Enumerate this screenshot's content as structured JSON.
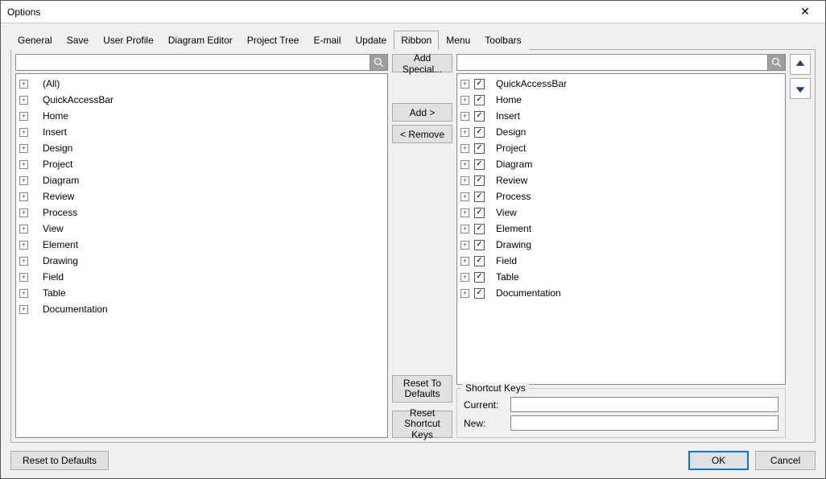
{
  "window": {
    "title": "Options"
  },
  "tabs": [
    {
      "label": "General"
    },
    {
      "label": "Save"
    },
    {
      "label": "User Profile"
    },
    {
      "label": "Diagram Editor"
    },
    {
      "label": "Project Tree"
    },
    {
      "label": "E-mail"
    },
    {
      "label": "Update"
    },
    {
      "label": "Ribbon"
    },
    {
      "label": "Menu"
    },
    {
      "label": "Toolbars"
    }
  ],
  "active_tab_index": 7,
  "left_search": "",
  "right_search": "",
  "left_tree": [
    {
      "label": "(All)"
    },
    {
      "label": "QuickAccessBar"
    },
    {
      "label": "Home"
    },
    {
      "label": "Insert"
    },
    {
      "label": "Design"
    },
    {
      "label": "Project"
    },
    {
      "label": "Diagram"
    },
    {
      "label": "Review"
    },
    {
      "label": "Process"
    },
    {
      "label": "View"
    },
    {
      "label": "Element"
    },
    {
      "label": "Drawing"
    },
    {
      "label": "Field"
    },
    {
      "label": "Table"
    },
    {
      "label": "Documentation"
    }
  ],
  "right_tree": [
    {
      "label": "QuickAccessBar",
      "checked": true
    },
    {
      "label": "Home",
      "checked": true
    },
    {
      "label": "Insert",
      "checked": true
    },
    {
      "label": "Design",
      "checked": true
    },
    {
      "label": "Project",
      "checked": true
    },
    {
      "label": "Diagram",
      "checked": true
    },
    {
      "label": "Review",
      "checked": true
    },
    {
      "label": "Process",
      "checked": true
    },
    {
      "label": "View",
      "checked": true
    },
    {
      "label": "Element",
      "checked": true
    },
    {
      "label": "Drawing",
      "checked": true
    },
    {
      "label": "Field",
      "checked": true
    },
    {
      "label": "Table",
      "checked": true
    },
    {
      "label": "Documentation",
      "checked": true
    }
  ],
  "buttons": {
    "add_special": "Add Special...",
    "add": "Add >",
    "remove": "< Remove",
    "reset_defaults_small": "Reset To Defaults",
    "reset_shortcut": "Reset Shortcut Keys",
    "reset_defaults": "Reset to Defaults",
    "ok": "OK",
    "cancel": "Cancel"
  },
  "shortcut": {
    "legend": "Shortcut Keys",
    "current_label": "Current:",
    "new_label": "New:",
    "current_value": "",
    "new_value": ""
  }
}
